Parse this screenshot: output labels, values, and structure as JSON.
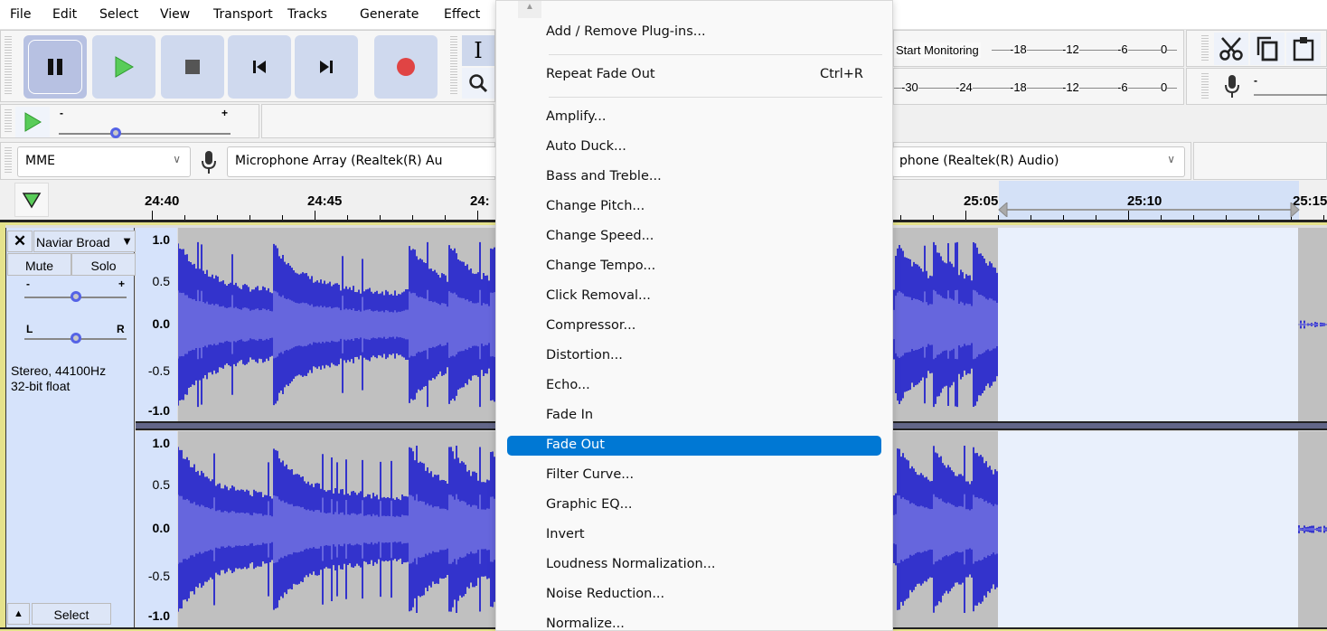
{
  "menubar": {
    "items": [
      "File",
      "Edit",
      "Select",
      "View",
      "Transport",
      "Tracks",
      "Generate",
      "Effect"
    ]
  },
  "transport": {
    "buttons": [
      {
        "name": "pause",
        "icon": "pause-icon",
        "active": true
      },
      {
        "name": "play",
        "icon": "play-icon"
      },
      {
        "name": "stop",
        "icon": "stop-icon"
      },
      {
        "name": "skip-to-start",
        "icon": "skip-start-icon"
      },
      {
        "name": "skip-to-end",
        "icon": "skip-end-icon"
      },
      {
        "name": "record",
        "icon": "record-icon"
      }
    ],
    "colors": {
      "play": "#4cc24c",
      "record": "#e04040",
      "button_bg": "#cfd9ee"
    }
  },
  "tools": {
    "selection_tool": "I",
    "zoom_tool": "zoom-icon"
  },
  "play_at_speed": {
    "minus": "-",
    "plus": "+",
    "value_fraction": 0.33
  },
  "meters": {
    "playback_button": "Start Monitoring",
    "playback_ticks": [
      "-18",
      "-12",
      "-6",
      "0"
    ],
    "record_ticks": [
      "-30",
      "-24",
      "-18",
      "-12",
      "-6",
      "0"
    ]
  },
  "edit_tools": [
    "cut-icon",
    "copy-icon",
    "paste-icon"
  ],
  "record_volume": {
    "minus": "-"
  },
  "device": {
    "host": "MME",
    "input": "Microphone Array (Realtek(R) Au",
    "output": "phone (Realtek(R) Audio)"
  },
  "timeline": {
    "labels": [
      {
        "text": "24:40"
      },
      {
        "text": "24:45"
      },
      {
        "text": "24:"
      },
      {
        "text": "25:05"
      },
      {
        "text": "25:10"
      },
      {
        "text": "25:15"
      }
    ],
    "selection": {
      "start": "25:05",
      "end": "25:15"
    }
  },
  "track": {
    "name": "Naviar Broad",
    "mute": "Mute",
    "solo": "Solo",
    "gain_minus": "-",
    "gain_plus": "+",
    "gain_fraction": 0.5,
    "pan_left": "L",
    "pan_right": "R",
    "pan_fraction": 0.5,
    "info_line1": "Stereo, 44100Hz",
    "info_line2": "32-bit float",
    "select": "Select",
    "scale": [
      "1.0",
      "0.5",
      "0.0",
      "-0.5",
      "-1.0"
    ],
    "wave_color": "#3333cc",
    "wave_rms_color": "#6666dd"
  },
  "effect_menu": {
    "top": "Add / Remove Plug-ins...",
    "repeat": {
      "label": "Repeat Fade Out",
      "shortcut": "Ctrl+R"
    },
    "items": [
      "Amplify...",
      "Auto Duck...",
      "Bass and Treble...",
      "Change Pitch...",
      "Change Speed...",
      "Change Tempo...",
      "Click Removal...",
      "Compressor...",
      "Distortion...",
      "Echo...",
      "Fade In",
      "Fade Out",
      "Filter Curve...",
      "Graphic EQ...",
      "Invert",
      "Loudness Normalization...",
      "Noise Reduction...",
      "Normalize..."
    ],
    "highlighted": "Fade Out",
    "highlight_color": "#0078d4"
  }
}
